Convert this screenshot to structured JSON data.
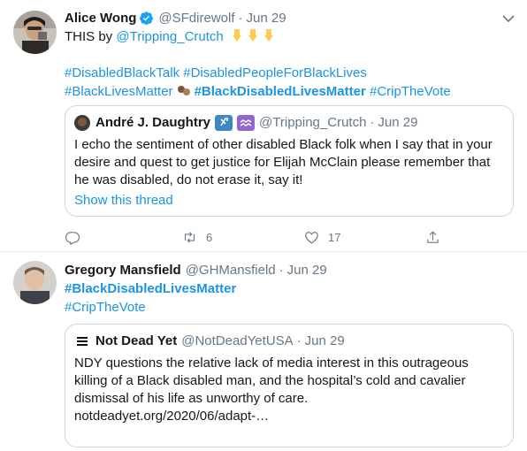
{
  "tweets": [
    {
      "name": "Alice Wong",
      "handle": "@SFdirewolf",
      "separator": "·",
      "date": "Jun 29",
      "text_prefix": "THIS by ",
      "mention": "@Tripping_Crutch",
      "hashtags_line1": "#DisabledBlackTalk #DisabledPeopleForBlackLives",
      "hashtags_line2a": "#BlackLivesMatter",
      "hashtags_line2b": "#BlackDisabledLivesMatter",
      "hashtags_line2c": "#CripTheVote",
      "quote": {
        "name": "André J. Daughtry",
        "handle": "@Tripping_Crutch",
        "separator": "·",
        "date": "Jun 29",
        "text": "I echo the sentiment of other disabled Black folk when I say that in your desire and quest to get justice for Elijah McClain please remember that he was disabled, do not erase it, say it!",
        "show_thread": "Show this thread"
      },
      "actions": {
        "reply_count": "",
        "retweet_count": "6",
        "like_count": "17"
      }
    },
    {
      "name": "Gregory Mansfield",
      "handle": "@GHMansfield",
      "separator": "·",
      "date": "Jun 29",
      "hashtag1": "#BlackDisabledLivesMatter",
      "hashtag2": "#CripTheVote",
      "quote": {
        "name": "Not Dead Yet",
        "handle": "@NotDeadYetUSA",
        "separator": "·",
        "date": "Jun 29",
        "text": "NDY questions the relative lack of media interest in this outrageous killing of a Black disabled man, and the hospital’s cold and cavalier dismissal of his life as unworthy of care. notdeadyet.org/2020/06/adapt-…"
      }
    }
  ],
  "colors": {
    "link": "#1b95e0",
    "secondary_text": "#657786",
    "border": "#ccd6dd",
    "verified": "#1da1f2"
  }
}
